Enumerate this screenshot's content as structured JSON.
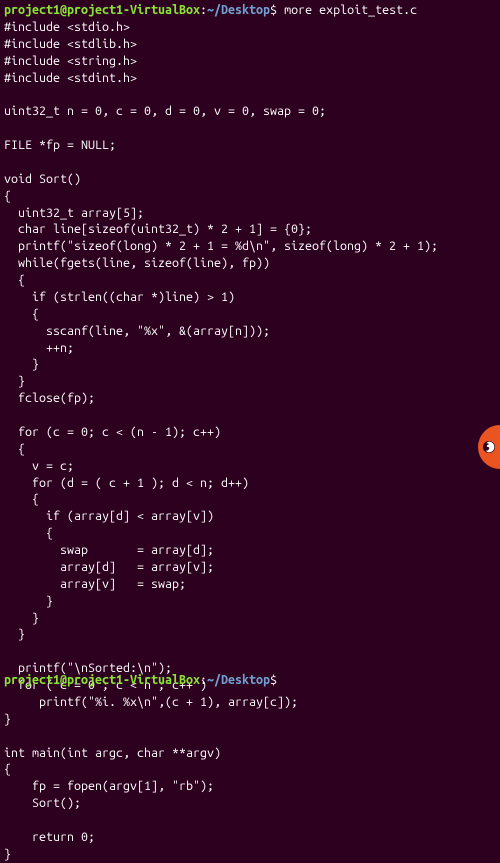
{
  "prompt": {
    "user_host": "project1@project1-VirtualBox",
    "separator": ":",
    "path": "~/Desktop",
    "symbol": "$"
  },
  "command": "more exploit_test.c",
  "code_lines": [
    "#include <stdio.h>",
    "#include <stdlib.h>",
    "#include <string.h>",
    "#include <stdint.h>",
    "",
    "uint32_t n = 0, c = 0, d = 0, v = 0, swap = 0;",
    "",
    "FILE *fp = NULL;",
    "",
    "void Sort()",
    "{",
    "  uint32_t array[5];",
    "  char line[sizeof(uint32_t) * 2 + 1] = {0};",
    "  printf(\"sizeof(long) * 2 + 1 = %d\\n\", sizeof(long) * 2 + 1);",
    "  while(fgets(line, sizeof(line), fp))",
    "  {",
    "    if (strlen((char *)line) > 1)",
    "    {",
    "      sscanf(line, \"%x\", &(array[n]));",
    "      ++n;",
    "    }",
    "  }",
    "  fclose(fp);",
    "",
    "  for (c = 0; c < (n - 1); c++)",
    "  {",
    "    v = c;",
    "    for (d = ( c + 1 ); d < n; d++)",
    "    {",
    "      if (array[d] < array[v])",
    "      {",
    "        swap       = array[d];",
    "        array[d]   = array[v];",
    "        array[v]   = swap;",
    "      }",
    "    }",
    "  }",
    "",
    "  printf(\"\\nSorted:\\n\");",
    "  for ( c = 0 ; c < n ; c++ )",
    "     printf(\"%i. %x\\n\",(c + 1), array[c]);",
    "}",
    "",
    "int main(int argc, char **argv)",
    "{",
    "    fp = fopen(argv[1], \"rb\");",
    "    Sort();",
    "",
    "    return 0;",
    "}"
  ],
  "side_indicator": {
    "icon": "firefox"
  }
}
